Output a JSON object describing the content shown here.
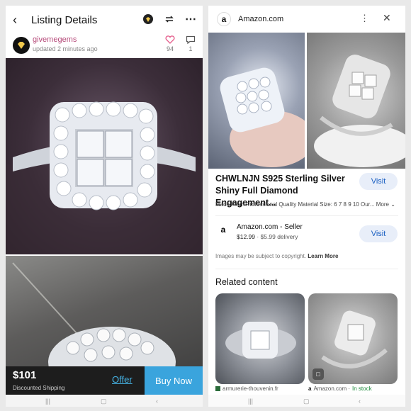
{
  "left": {
    "header": {
      "title": "Listing Details"
    },
    "seller": {
      "name": "givemegems",
      "updated": "updated 2 minutes ago"
    },
    "stats": {
      "likes": "94",
      "comments": "1"
    },
    "price": "$101",
    "shipping": "Discounted Shipping",
    "offer_label": "Offer",
    "buy_label": "Buy Now"
  },
  "right": {
    "header": {
      "site": "Amazon.com"
    },
    "product": {
      "title": "CHWLNJN S925 Sterling Silver Shiny Full Diamond Engagement...",
      "visit_label": "Visit",
      "material": "Made From Professional Quality Material Size: 6 7 8 9 10 Our...",
      "more_label": "More"
    },
    "seller": {
      "name": "Amazon.com - Seller",
      "price": "$12.99",
      "delivery": "· $5.99 delivery",
      "visit_label": "Visit"
    },
    "copyright": {
      "text": "Images may be subject to copyright.",
      "link": "Learn More"
    },
    "related": {
      "heading": "Related content",
      "items": [
        {
          "source": "armurerie-thouvenin.fr",
          "stock": ""
        },
        {
          "source": "Amazon.com ·",
          "stock": "In stock"
        }
      ]
    }
  },
  "colors": {
    "accent_blue": "#3aa4dd",
    "link_blue": "#1a5fc2",
    "in_stock": "#1b8a3a",
    "seller_pink": "#b64b7a"
  },
  "icons": [
    "back-arrow-icon",
    "badge-icon",
    "repost-icon",
    "more-icon",
    "heart-icon",
    "comment-icon",
    "amazon-logo-icon",
    "close-icon",
    "chevron-down-icon",
    "image-badge-icon"
  ]
}
